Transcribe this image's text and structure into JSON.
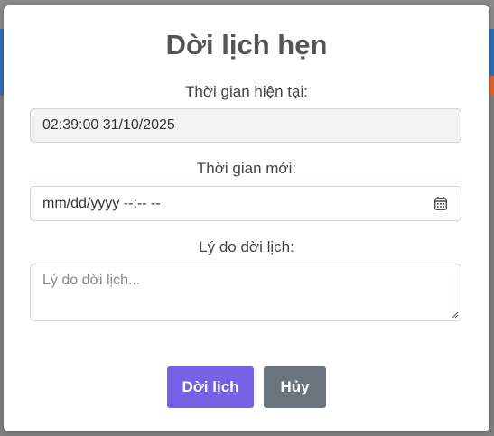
{
  "modal": {
    "title": "Dời lịch hẹn",
    "current_time_label": "Thời gian hiện tại:",
    "current_time_value": "02:39:00 31/10/2025",
    "new_time_label": "Thời gian mới:",
    "new_time_placeholder": "mm/dd/yyyy --:-- --",
    "reason_label": "Lý do dời lịch:",
    "reason_placeholder": "Lý do dời lịch...",
    "submit_label": "Dời lịch",
    "cancel_label": "Hủy"
  },
  "colors": {
    "submit_button": "#7561e6",
    "cancel_button": "#6b747d",
    "title_text": "#555555"
  },
  "icons": {
    "calendar": "calendar-icon",
    "resize": "resize-handle-icon"
  }
}
